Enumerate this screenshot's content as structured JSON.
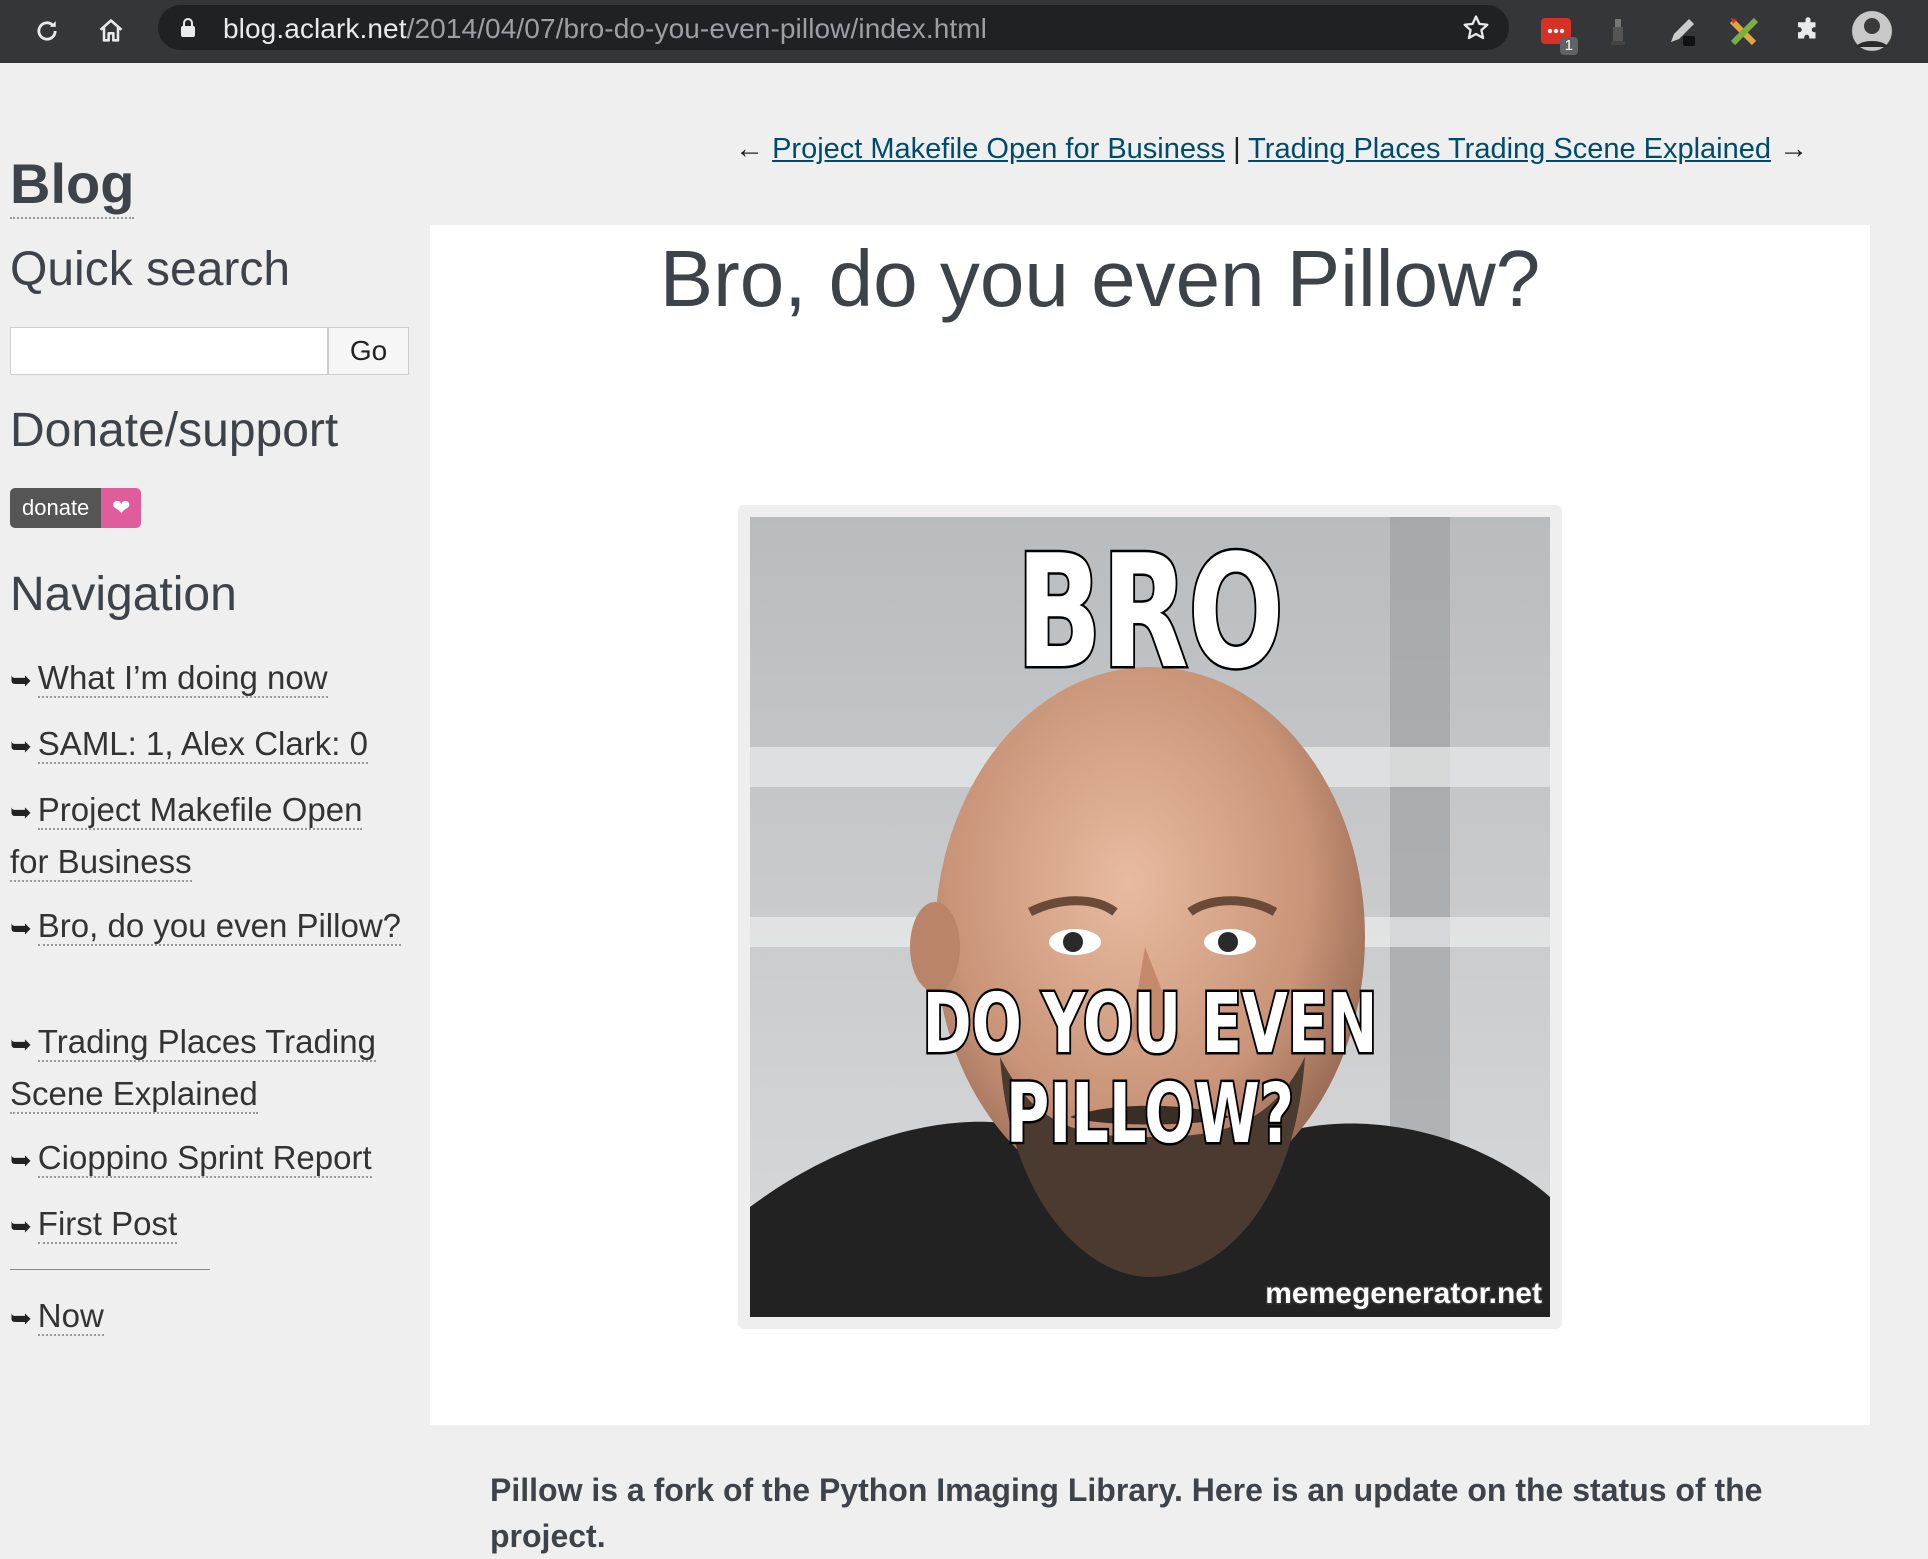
{
  "browser": {
    "url_host": "blog.aclark.net",
    "url_path": "/2014/04/07/bro-do-you-even-pillow/index.html",
    "ext_badge": "1"
  },
  "sidebar": {
    "blog_title": "Blog",
    "quick_search_heading": "Quick search",
    "search_value": "",
    "search_button": "Go",
    "donate_heading": "Donate/support",
    "donate_label": "donate",
    "navigation_heading": "Navigation",
    "nav_items": [
      {
        "label": "What I’m doing now"
      },
      {
        "label": "SAML: 1, Alex Clark: 0"
      },
      {
        "label": "Project Makefile Open for Business"
      },
      {
        "label": "Bro, do you even Pillow?"
      },
      {
        "label": "Trading Places Trading Scene Explained"
      },
      {
        "label": "Cioppino Sprint Report"
      },
      {
        "label": "First Post"
      },
      {
        "label": "Now"
      }
    ],
    "arrow_glyph": "➥"
  },
  "prevnext": {
    "prev_arrow": "←",
    "prev_label": "Project Makefile Open for Business",
    "separator": "|",
    "next_label": "Trading Places Trading Scene Explained",
    "next_arrow": "→"
  },
  "post": {
    "title": "Bro, do you even Pillow?",
    "meme_top": "BRO",
    "meme_bottom_1": "DO YOU EVEN",
    "meme_bottom_2": "PILLOW?",
    "meme_watermark": "memegenerator.net",
    "intro": "Pillow is a fork of the Python Imaging Library. Here is an update on the status of the project."
  }
}
